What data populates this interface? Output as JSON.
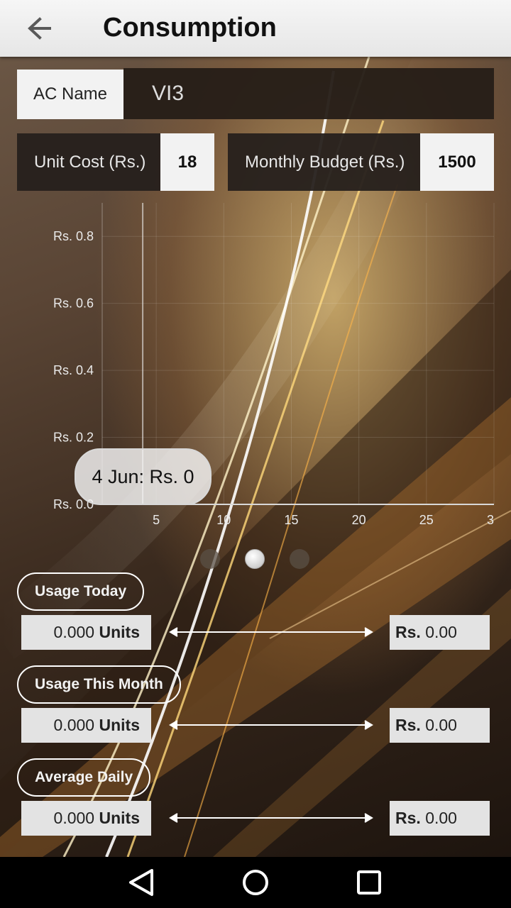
{
  "app_bar": {
    "title": "Consumption",
    "back_icon": "arrow-left-icon"
  },
  "account": {
    "label": "AC Name",
    "value": "VI3"
  },
  "rates": {
    "unit_cost_label": "Unit Cost (Rs.)",
    "unit_cost_value": "18",
    "budget_label": "Monthly Budget (Rs.)",
    "budget_value": "1500"
  },
  "chart_data": {
    "type": "line",
    "x_ticks": [
      "5",
      "10",
      "15",
      "20",
      "25",
      "3"
    ],
    "y_ticks": [
      "Rs. 0.0",
      "Rs. 0.2",
      "Rs. 0.4",
      "Rs. 0.6",
      "Rs. 0.8"
    ],
    "xlim": [
      1,
      30
    ],
    "ylim": [
      0,
      0.9
    ],
    "grid": true,
    "cursor_x": 4,
    "tooltip": "4 Jun: Rs. 0"
  },
  "pager": {
    "count": 3,
    "active": 1
  },
  "usage": [
    {
      "label": "Usage Today",
      "units_value": "0.000",
      "units_word": "Units",
      "rs_prefix": "Rs.",
      "rs_value": "0.00"
    },
    {
      "label": "Usage This Month",
      "units_value": "0.000",
      "units_word": "Units",
      "rs_prefix": "Rs.",
      "rs_value": "0.00"
    },
    {
      "label": "Average Daily",
      "units_value": "0.000",
      "units_word": "Units",
      "rs_prefix": "Rs.",
      "rs_value": "0.00"
    }
  ],
  "nav": {
    "back_icon": "triangle-back-icon",
    "home_icon": "circle-home-icon",
    "recents_icon": "square-recents-icon"
  }
}
